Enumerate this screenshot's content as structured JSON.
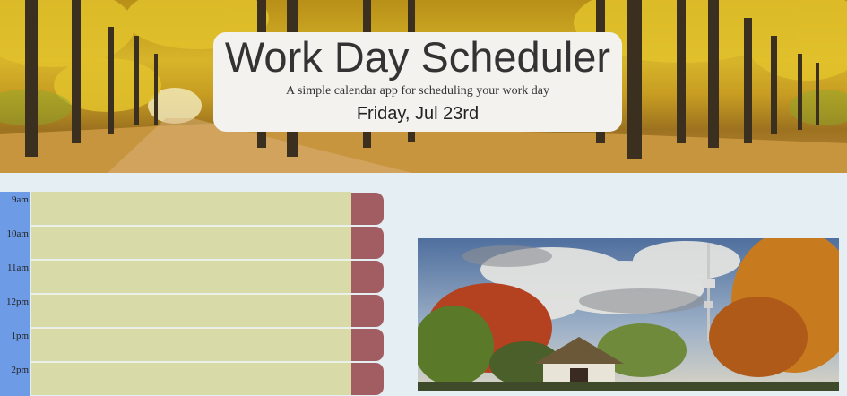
{
  "header": {
    "title": "Work Day Scheduler",
    "lead": "A simple calendar app for scheduling your work day",
    "current_day": "Friday, Jul 23rd"
  },
  "schedule": {
    "rows": [
      {
        "hour": "9am",
        "text": ""
      },
      {
        "hour": "10am",
        "text": ""
      },
      {
        "hour": "11am",
        "text": ""
      },
      {
        "hour": "12pm",
        "text": ""
      },
      {
        "hour": "1pm",
        "text": ""
      },
      {
        "hour": "2pm",
        "text": ""
      }
    ]
  },
  "colors": {
    "hour_column": "#6e9be6",
    "future_row": "#d8dba8",
    "save_button": "#a25d62",
    "page_background": "#e5eef2"
  },
  "icons": {
    "save": "save-icon"
  }
}
